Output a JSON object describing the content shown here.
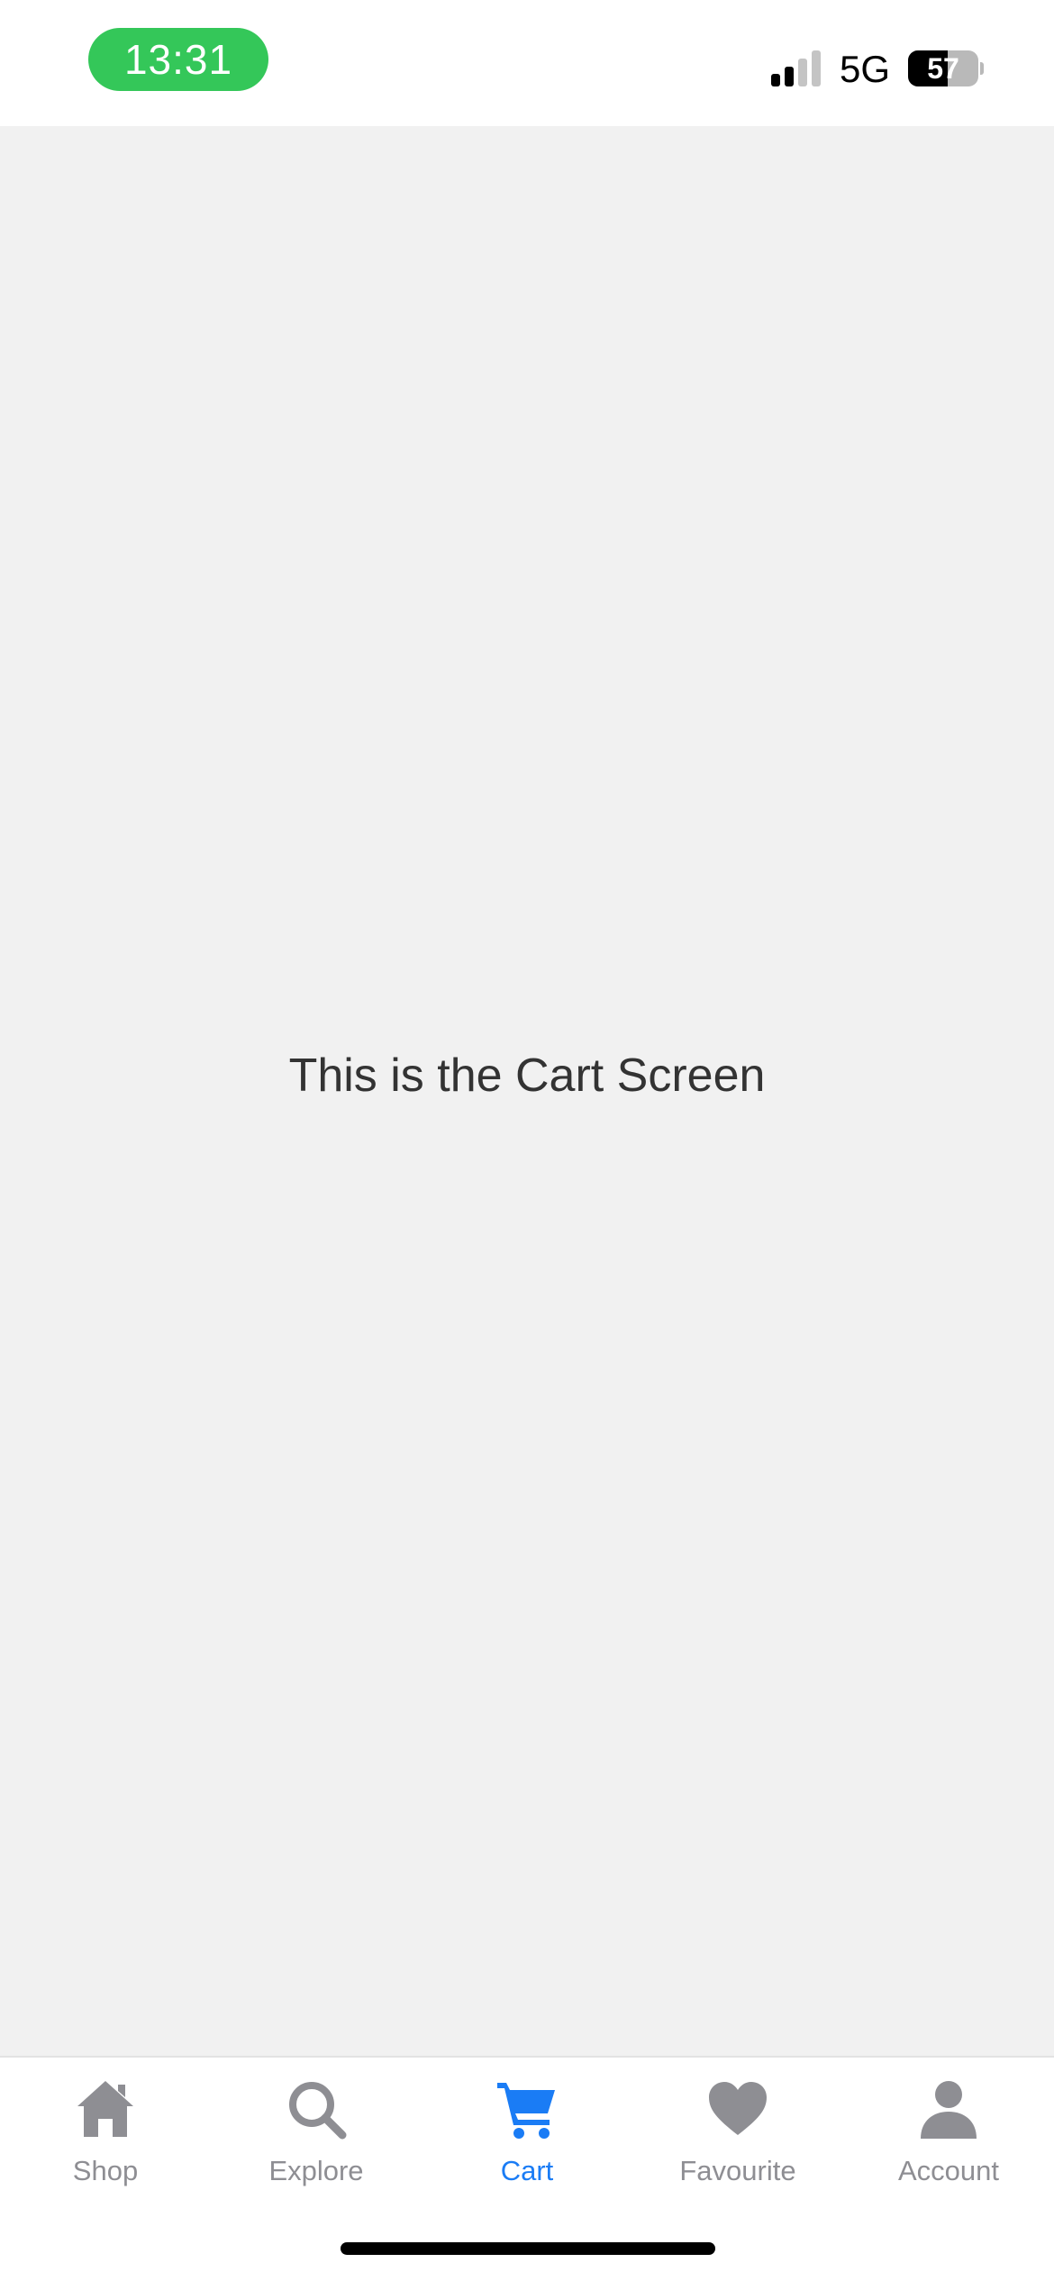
{
  "status_bar": {
    "time": "13:31",
    "network": "5G",
    "battery_level": 57,
    "battery_text": "57"
  },
  "main": {
    "message": "This is the Cart Screen"
  },
  "tab_bar": {
    "active_color": "#1a7cf5",
    "inactive_color": "#8e8e93",
    "tabs": [
      {
        "label": "Shop",
        "icon": "home-icon",
        "active": false
      },
      {
        "label": "Explore",
        "icon": "search-icon",
        "active": false
      },
      {
        "label": "Cart",
        "icon": "cart-icon",
        "active": true
      },
      {
        "label": "Favourite",
        "icon": "heart-icon",
        "active": false
      },
      {
        "label": "Account",
        "icon": "person-icon",
        "active": false
      }
    ]
  }
}
